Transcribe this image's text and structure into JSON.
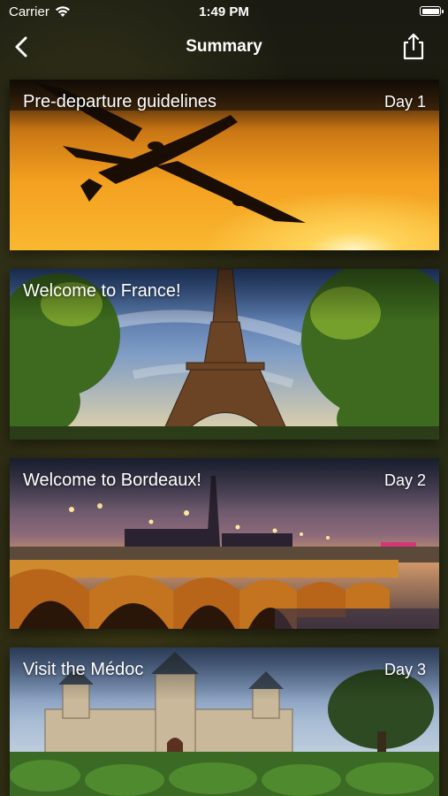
{
  "status_bar": {
    "carrier": "Carrier",
    "time": "1:49 PM"
  },
  "nav": {
    "title": "Summary",
    "back_icon": "chevron-left-icon",
    "share_icon": "share-icon"
  },
  "cards": [
    {
      "title": "Pre-departure guidelines",
      "day": "Day 1",
      "image": "airplane-sunset"
    },
    {
      "title": "Welcome to France!",
      "day": "",
      "image": "eiffel-tower"
    },
    {
      "title": "Welcome to Bordeaux!",
      "day": "Day 2",
      "image": "bordeaux-bridge-night"
    },
    {
      "title": "Visit the Médoc",
      "day": "Day 3",
      "image": "medoc-chateau-vineyard"
    }
  ]
}
